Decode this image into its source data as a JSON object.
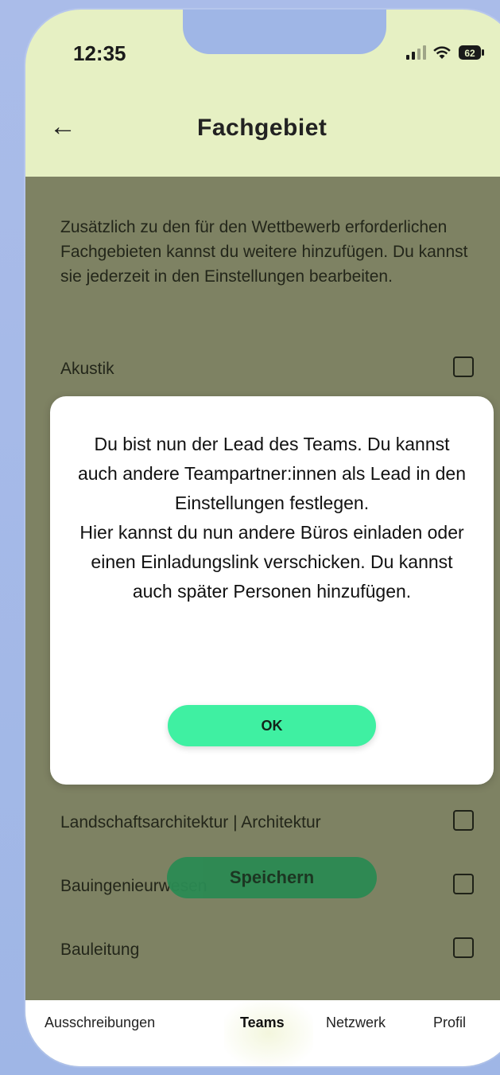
{
  "status_bar": {
    "time": "12:35",
    "battery": "62"
  },
  "header": {
    "title": "Fachgebiet"
  },
  "content": {
    "intro": "Zusätzlich zu den für den Wettbewerb erforderlichen Fachgebieten kannst du weitere hinzufügen. Du kannst sie jederzeit in den Einstellungen bearbeiten.",
    "options": [
      {
        "label": "Akustik",
        "checked": false
      },
      {
        "label": "Landschaftsarchitektur | Architektur",
        "checked": false
      },
      {
        "label": "Bauingenieurwesen",
        "checked": false
      },
      {
        "label": "Bauleitung",
        "checked": false
      }
    ],
    "save_label": "Speichern"
  },
  "modal": {
    "message": "Du bist nun der Lead des Teams. Du kannst auch andere Teampartner:innen als Lead in den Einstellungen festlegen.\nHier kannst du nun andere Büros einladen oder einen Einladungslink verschicken. Du kannst auch später Personen hinzufügen.",
    "ok_label": "OK"
  },
  "nav": {
    "items": [
      {
        "label": "Ausschreibungen",
        "active": false
      },
      {
        "label": "Teams",
        "active": true
      },
      {
        "label": "Netzwerk",
        "active": false
      },
      {
        "label": "Profil",
        "active": false
      }
    ]
  },
  "colors": {
    "header_bg": "#e6f0c3",
    "dim_overlay": "#7e8263",
    "ok_button": "#3ff0a2",
    "save_button": "#2b8a53"
  }
}
